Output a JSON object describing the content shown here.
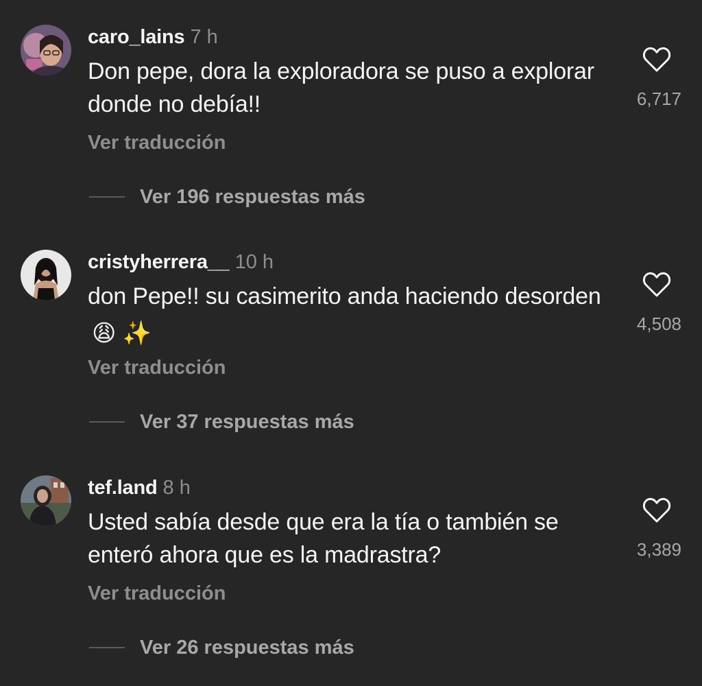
{
  "comments": [
    {
      "username": "caro_lains",
      "time": "7 h",
      "text": "Don pepe, dora la exploradora se puso a explorar donde no debía!!",
      "emoji": "",
      "translate_label": "Ver traducción",
      "replies_label": "Ver 196 respuestas más",
      "likes": "6,717"
    },
    {
      "username": "cristyherrera__",
      "time": "10 h",
      "text": "don Pepe!! su casimerito anda haciendo desorden",
      "emoji": "😩 ✨",
      "translate_label": "Ver traducción",
      "replies_label": "Ver 37 respuestas más",
      "likes": "4,508"
    },
    {
      "username": "tef.land",
      "time": "8 h",
      "text": "Usted sabía desde que era la tía o también se enteró ahora que es la madrastra?",
      "emoji": "",
      "translate_label": "Ver traducción",
      "replies_label": "Ver 26 respuestas más",
      "likes": "3,389"
    }
  ],
  "icons": {
    "like": "heart-outline-icon",
    "emoji_weary": "weary-face-emoji",
    "emoji_sparkles": "sparkles-emoji"
  },
  "colors": {
    "background": "#262626",
    "primary_text": "#f5f5f5",
    "secondary_text": "#8e8e8e",
    "replies_text": "#a8a8a8"
  }
}
